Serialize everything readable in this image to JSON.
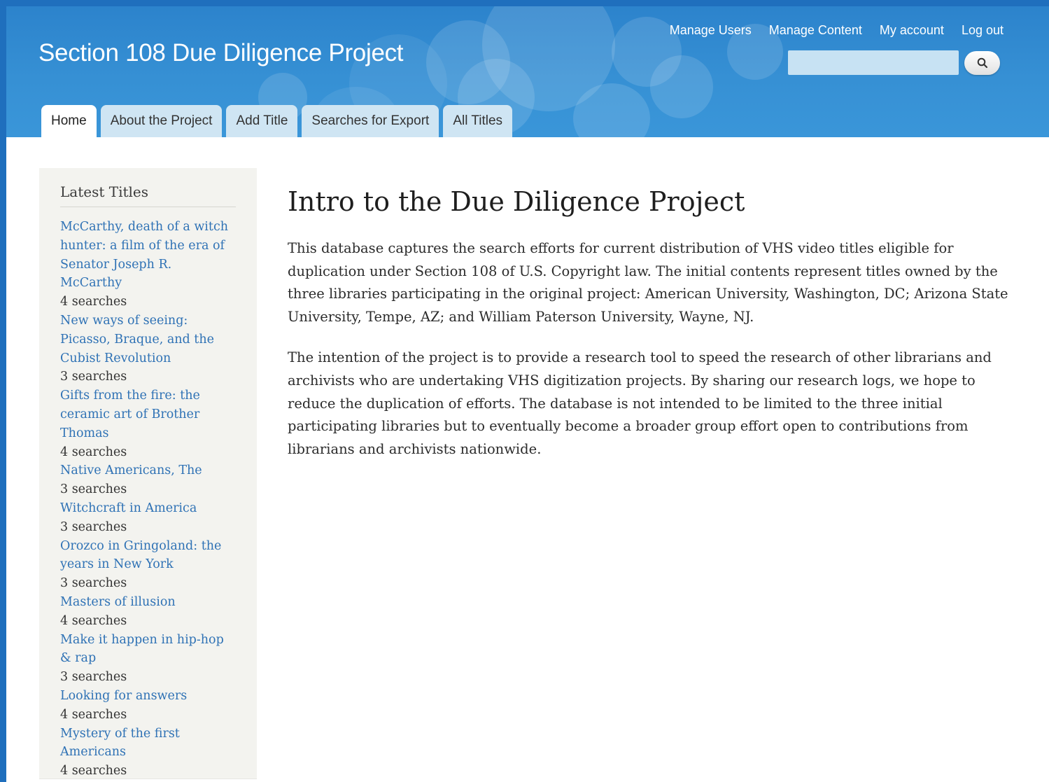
{
  "site": {
    "name": "Section 108 Due Diligence Project"
  },
  "colors": {
    "header_blue": "#3690d4",
    "link": "#2f72b5",
    "sidebar_bg": "#f3f3ef"
  },
  "secondary_menu": [
    {
      "label": "Manage Users"
    },
    {
      "label": "Manage Content"
    },
    {
      "label": "My account"
    },
    {
      "label": "Log out"
    }
  ],
  "search": {
    "value": "",
    "button_icon": "search-icon"
  },
  "tabs": [
    {
      "label": "Home",
      "active": true
    },
    {
      "label": "About the Project",
      "active": false
    },
    {
      "label": "Add Title",
      "active": false
    },
    {
      "label": "Searches for Export",
      "active": false
    },
    {
      "label": "All Titles",
      "active": false
    }
  ],
  "sidebar": {
    "title": "Latest Titles",
    "items": [
      {
        "title": "McCarthy, death of a witch hunter: a film of the era of Senator Joseph R. McCarthy",
        "count": "4 searches"
      },
      {
        "title": "New ways of seeing: Picasso, Braque, and the Cubist Revolution",
        "count": "3 searches"
      },
      {
        "title": "Gifts from the fire: the ceramic art of Brother Thomas",
        "count": "4 searches"
      },
      {
        "title": "Native Americans, The",
        "count": "3 searches"
      },
      {
        "title": "Witchcraft in America",
        "count": "3 searches"
      },
      {
        "title": "Orozco in Gringoland: the years in New York",
        "count": "3 searches"
      },
      {
        "title": "Masters of illusion",
        "count": "4 searches"
      },
      {
        "title": "Make it happen in hip-hop & rap",
        "count": "3 searches"
      },
      {
        "title": "Looking for answers",
        "count": "4 searches"
      },
      {
        "title": "Mystery of the first Americans",
        "count": "4 searches"
      }
    ]
  },
  "main": {
    "heading": "Intro to the Due Diligence Project",
    "paragraphs": [
      "This database captures the search efforts for current distribution of VHS video titles eligible for duplication under Section 108 of U.S. Copyright law. The initial contents represent titles owned by the three libraries participating in the original project: American University, Washington, DC; Arizona State University, Tempe, AZ; and William Paterson University, Wayne, NJ.",
      "The intention of the project is to provide a research tool to speed the research of other librarians and archivists who are undertaking VHS digitization projects. By sharing our research logs, we hope to reduce the duplication of efforts. The database is not intended to be limited to the three initial participating libraries but to eventually become a broader group effort open to contributions from librarians and archivists nationwide."
    ]
  }
}
